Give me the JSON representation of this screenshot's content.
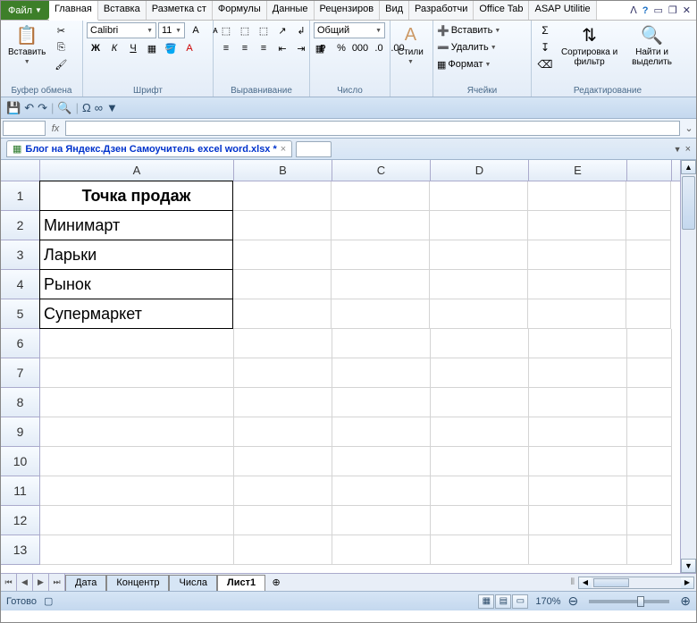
{
  "tabs": {
    "file": "Файл",
    "list": [
      "Главная",
      "Вставка",
      "Разметка ст",
      "Формулы",
      "Данные",
      "Рецензиров",
      "Вид",
      "Разработчи",
      "Office Tab",
      "ASAP Utilitie"
    ],
    "active_index": 0
  },
  "ribbon": {
    "clipboard": {
      "paste": "Вставить",
      "title": "Буфер обмена"
    },
    "font": {
      "name": "Calibri",
      "size": "11",
      "title": "Шрифт"
    },
    "align": {
      "title": "Выравнивание"
    },
    "number": {
      "format": "Общий",
      "title": "Число"
    },
    "styles": {
      "btn": "Стили",
      "title": ""
    },
    "cells": {
      "insert": "Вставить",
      "delete": "Удалить",
      "format": "Формат",
      "title": "Ячейки"
    },
    "editing": {
      "sort": "Сортировка и фильтр",
      "find": "Найти и выделить",
      "title": "Редактирование"
    }
  },
  "doc_tab": {
    "name": "Блог на Яндекс.Дзен Самоучитель excel word.xlsx *"
  },
  "columns": [
    "A",
    "B",
    "C",
    "D",
    "E"
  ],
  "rows": [
    1,
    2,
    3,
    4,
    5,
    6,
    7,
    8,
    9,
    10,
    11,
    12,
    13
  ],
  "cells": {
    "A1": "Точка продаж",
    "A2": "Минимарт",
    "A3": "Ларьки",
    "A4": "Рынок",
    "A5": "Супермаркет"
  },
  "sheets": {
    "list": [
      "Дата",
      "Концентр",
      "Числа",
      "Лист1"
    ],
    "active_index": 3
  },
  "status": {
    "ready": "Готово",
    "zoom": "170%"
  }
}
